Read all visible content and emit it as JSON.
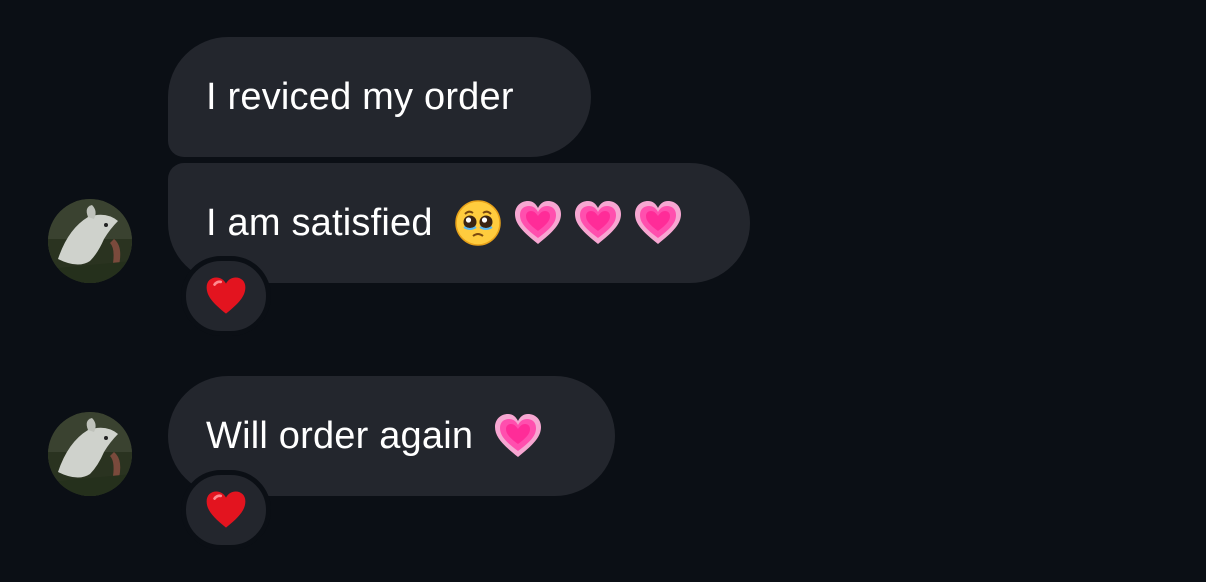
{
  "conversation": {
    "messages": [
      {
        "text": "I reviced my order",
        "emojis": [],
        "reaction": null
      },
      {
        "text": "I am satisfied",
        "emojis": [
          "pleading-face",
          "growing-heart",
          "growing-heart",
          "growing-heart"
        ],
        "reaction": "red-heart"
      },
      {
        "text": "Will order again",
        "emojis": [
          "growing-heart"
        ],
        "reaction": "red-heart"
      }
    ]
  },
  "colors": {
    "background": "#0b0f15",
    "bubble": "#23262d",
    "text": "#ffffff",
    "heart_pink": "#ff3fa4",
    "heart_red": "#e3141f"
  }
}
